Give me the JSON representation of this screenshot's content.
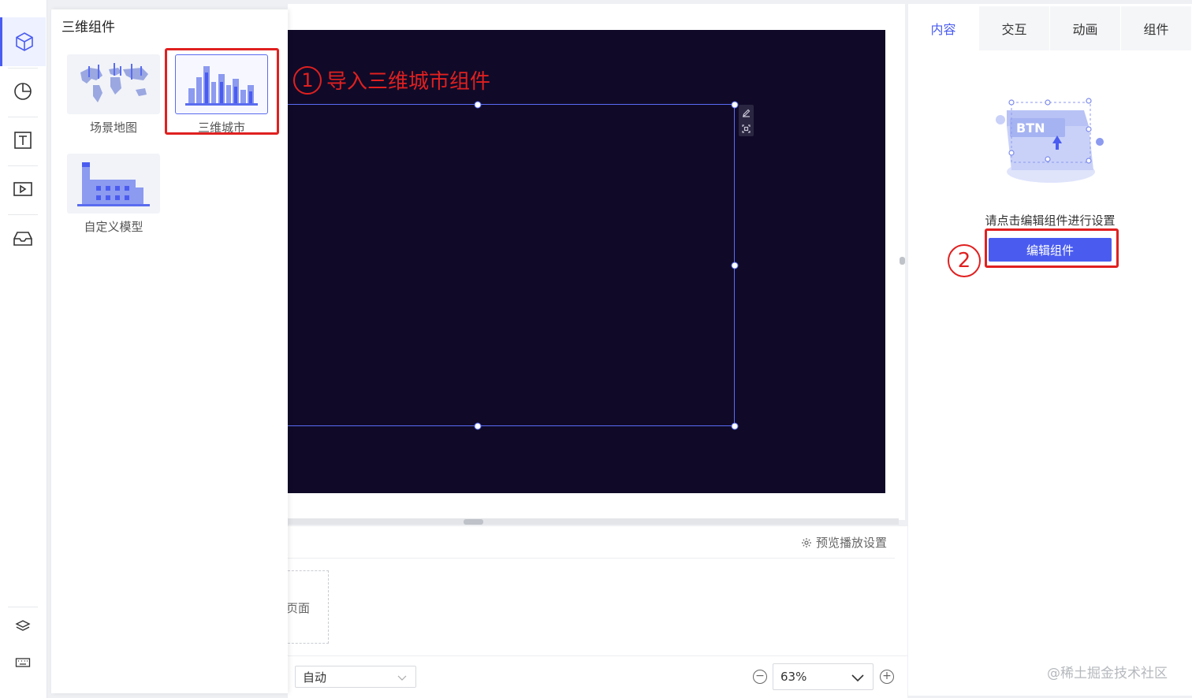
{
  "rail": {
    "items": [
      {
        "icon": "cube-icon",
        "active": true
      },
      {
        "icon": "pie-chart-icon"
      },
      {
        "icon": "text-icon"
      },
      {
        "icon": "media-icon"
      },
      {
        "icon": "inbox-icon"
      }
    ],
    "bottom_icons": [
      "layers-icon",
      "keyboard-icon"
    ]
  },
  "panel": {
    "title": "三维组件",
    "items": [
      {
        "label": "场景地图",
        "icon": "world-map-icon"
      },
      {
        "label": "三维城市",
        "icon": "city-buildings-icon",
        "selected": true
      },
      {
        "label": "自定义模型",
        "icon": "factory-model-icon"
      }
    ]
  },
  "annotations": {
    "step1_num": "1",
    "step1_text": "导入三维城市组件",
    "step2_num": "2"
  },
  "bottom": {
    "preview_settings": "预览播放设置",
    "page_label": "页面",
    "auto_select": "自动",
    "zoom_value": "63%"
  },
  "right": {
    "tabs": [
      "内容",
      "交互",
      "动画",
      "组件"
    ],
    "active_tab": "内容",
    "illustration_text": "BTN",
    "hint": "请点击编辑组件进行设置",
    "edit_button": "编辑组件"
  },
  "watermark": "@稀土掘金技术社区",
  "colors": {
    "accent": "#4a5cf0",
    "stage": "#100a28",
    "annotation": "#e02020"
  }
}
